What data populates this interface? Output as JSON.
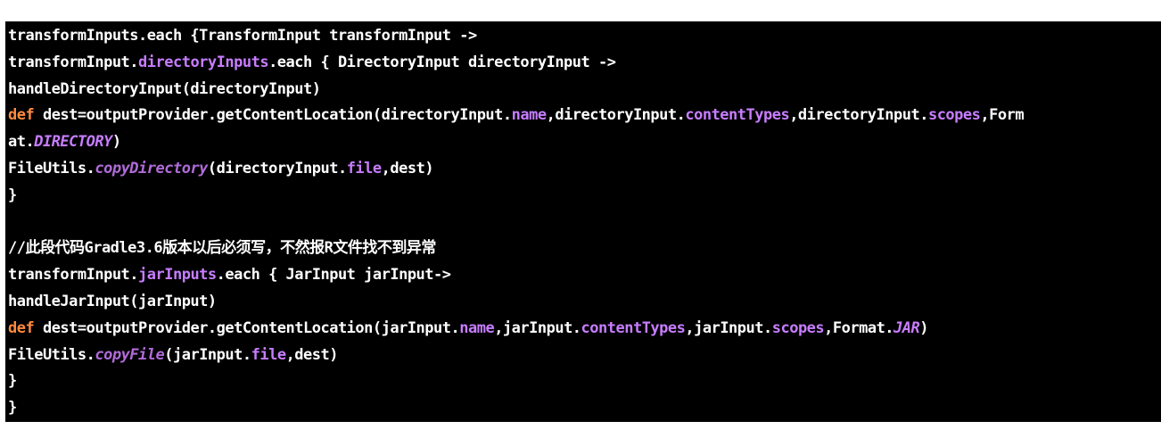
{
  "code": {
    "lines": [
      [
        {
          "t": "transformInputs.each {TransformInput transformInput ->",
          "c": ""
        }
      ],
      [
        {
          "t": "transformInput.",
          "c": ""
        },
        {
          "t": "directoryInputs",
          "c": "prop"
        },
        {
          "t": ".each { DirectoryInput directoryInput ->",
          "c": ""
        }
      ],
      [
        {
          "t": "handleDirectoryInput(directoryInput)",
          "c": ""
        }
      ],
      [
        {
          "t": "def",
          "c": "kw"
        },
        {
          "t": " dest=outputProvider.getContentLocation(directoryInput.",
          "c": ""
        },
        {
          "t": "name",
          "c": "prop"
        },
        {
          "t": ",directoryInput.",
          "c": ""
        },
        {
          "t": "contentTypes",
          "c": "prop"
        },
        {
          "t": ",directoryInput.",
          "c": ""
        },
        {
          "t": "scopes",
          "c": "prop"
        },
        {
          "t": ",Form",
          "c": ""
        }
      ],
      [
        {
          "t": "at.",
          "c": ""
        },
        {
          "t": "DIRECTORY",
          "c": "const"
        },
        {
          "t": ")",
          "c": ""
        }
      ],
      [
        {
          "t": "FileUtils.",
          "c": ""
        },
        {
          "t": "copyDirectory",
          "c": "ital"
        },
        {
          "t": "(directoryInput.",
          "c": ""
        },
        {
          "t": "file",
          "c": "prop"
        },
        {
          "t": ",dest)",
          "c": ""
        }
      ],
      [
        {
          "t": "}",
          "c": ""
        }
      ],
      [
        {
          "t": "",
          "c": ""
        }
      ],
      [
        {
          "t": "//此段代码Gradle3.6版本以后必须写，不然报R文件找不到异常",
          "c": "comment"
        }
      ],
      [
        {
          "t": "transformInput.",
          "c": ""
        },
        {
          "t": "jarInputs",
          "c": "prop"
        },
        {
          "t": ".each { JarInput jarInput->",
          "c": ""
        }
      ],
      [
        {
          "t": "handleJarInput(jarInput)",
          "c": ""
        }
      ],
      [
        {
          "t": "def",
          "c": "kw"
        },
        {
          "t": " dest=outputProvider.getContentLocation(jarInput.",
          "c": ""
        },
        {
          "t": "name",
          "c": "prop"
        },
        {
          "t": ",jarInput.",
          "c": ""
        },
        {
          "t": "contentTypes",
          "c": "prop"
        },
        {
          "t": ",jarInput.",
          "c": ""
        },
        {
          "t": "scopes",
          "c": "prop"
        },
        {
          "t": ",Format.",
          "c": ""
        },
        {
          "t": "JAR",
          "c": "const"
        },
        {
          "t": ")",
          "c": ""
        }
      ],
      [
        {
          "t": "FileUtils.",
          "c": ""
        },
        {
          "t": "copyFile",
          "c": "ital"
        },
        {
          "t": "(jarInput.",
          "c": ""
        },
        {
          "t": "file",
          "c": "prop"
        },
        {
          "t": ",dest)",
          "c": ""
        }
      ],
      [
        {
          "t": "}",
          "c": ""
        }
      ],
      [
        {
          "t": "}",
          "c": ""
        }
      ]
    ]
  },
  "colors": {
    "background": "#000000",
    "text": "#ffffff",
    "keyword": "#ff8a3d",
    "property": "#c77dff"
  }
}
